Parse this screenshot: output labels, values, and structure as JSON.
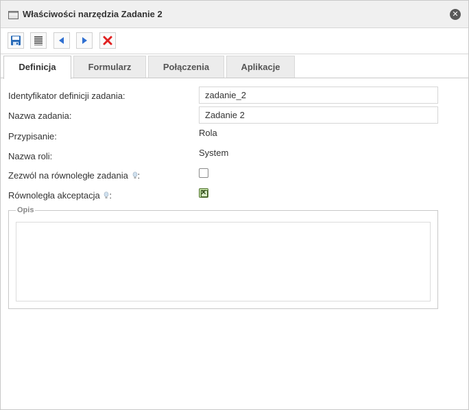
{
  "dialog": {
    "title": "Właściwości narzędzia Zadanie 2",
    "close_symbol": "✕"
  },
  "toolbar": {
    "buttons": [
      {
        "icon": "save-icon"
      },
      {
        "icon": "properties-icon"
      },
      {
        "icon": "arrow-left-icon"
      },
      {
        "icon": "arrow-right-icon"
      },
      {
        "icon": "delete-icon"
      }
    ]
  },
  "tabs": [
    {
      "label": "Definicja",
      "active": true
    },
    {
      "label": "Formularz",
      "active": false
    },
    {
      "label": "Połączenia",
      "active": false
    },
    {
      "label": "Aplikacje",
      "active": false
    }
  ],
  "form": {
    "task_id_label": "Identyfikator definicji zadania:",
    "task_id_value": "zadanie_2",
    "task_name_label": "Nazwa zadania:",
    "task_name_value": "Zadanie 2",
    "assignment_label": "Przypisanie:",
    "assignment_value": "Rola",
    "role_name_label": "Nazwa roli:",
    "role_name_value": "System",
    "parallel_tasks_label": "Zezwól na równoległe zadania",
    "parallel_tasks_checked": false,
    "parallel_accept_label": "Równoległa akceptacja",
    "parallel_accept_checked": true,
    "colon": ":"
  },
  "description": {
    "legend": "Opis",
    "value": ""
  },
  "colors": {
    "save": "#2b6cb8",
    "arrow": "#2f6fd1",
    "delete": "#e02020",
    "check_green": "#b8d79a"
  }
}
